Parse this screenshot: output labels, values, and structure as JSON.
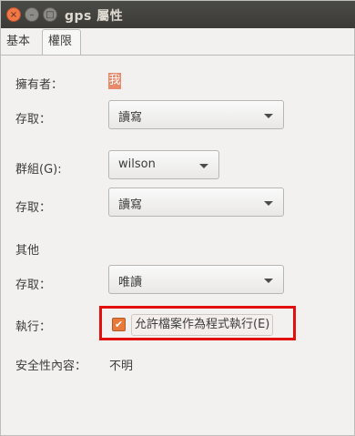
{
  "window": {
    "title": "gps 屬性"
  },
  "title_buttons": {
    "close": "×",
    "minimize": "–",
    "maximize": "□"
  },
  "tabs": [
    {
      "label": "基本"
    },
    {
      "label": "權限"
    }
  ],
  "permissions": {
    "owner_label": "擁有者：",
    "owner_value": "我",
    "owner_access_label": "存取：",
    "owner_access_value": "讀寫",
    "group_label": "群組(G):",
    "group_value": "wilson",
    "group_access_label": "存取：",
    "group_access_value": "讀寫",
    "others_heading": "其他",
    "others_access_label": "存取：",
    "others_access_value": "唯讀",
    "execute_label": "執行：",
    "execute_checkbox_label": "允許檔案作為程式執行(E)",
    "execute_checked": true,
    "check_mark": "✔",
    "security_context_label": "安全性內容：",
    "security_context_value": "不明"
  }
}
